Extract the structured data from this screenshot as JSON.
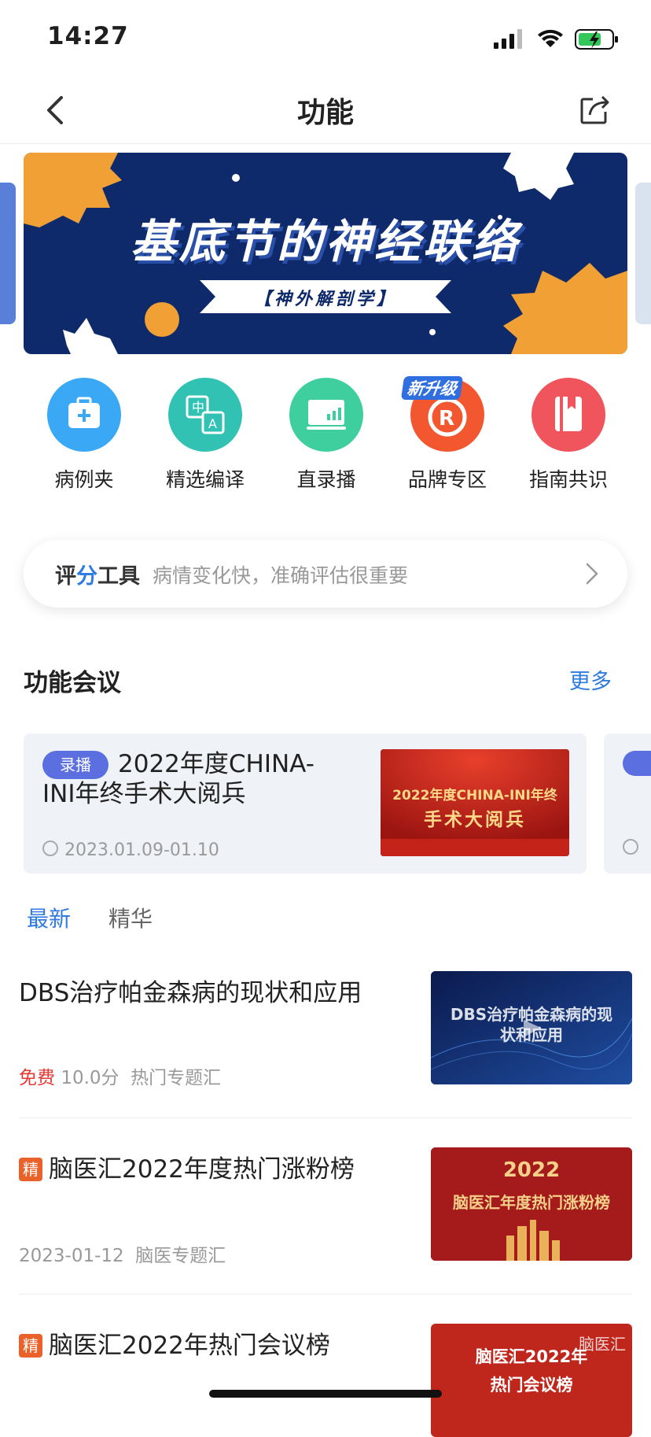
{
  "status_bar": {
    "time": "14:27"
  },
  "nav": {
    "title": "功能"
  },
  "banner": {
    "title": "基底节的神经联络",
    "subtitle": "【神外解剖学】"
  },
  "features": [
    {
      "label": "病例夹",
      "color": "#3aa8f5"
    },
    {
      "label": "精选编译",
      "color": "#31c2b4"
    },
    {
      "label": "直录播",
      "color": "#3fcf9e"
    },
    {
      "label": "品牌专区",
      "color": "#f2572f",
      "badge": "新升级"
    },
    {
      "label": "指南共识",
      "color": "#f0545c"
    }
  ],
  "score_tool": {
    "title_part1": "评",
    "title_part2": "分",
    "title_part3": "工具",
    "description": "病情变化快，准确评估很重要"
  },
  "section": {
    "title": "功能会议",
    "more": "更多"
  },
  "conference": {
    "tag": "录播",
    "title": "2022年度CHINA-INI年终手术大阅兵",
    "date": "2023.01.09-01.10",
    "image_line1": "2022年度CHINA-INI年终",
    "image_line2": "手术大阅兵"
  },
  "tabs": [
    {
      "label": "最新",
      "active": true
    },
    {
      "label": "精华",
      "active": false
    }
  ],
  "articles": [
    {
      "title": "DBS治疗帕金森病的现状和应用",
      "free": "免费",
      "score": "10.0分",
      "category": "热门专题汇",
      "thumb_text": "DBS治疗帕金森病的现状和应用"
    },
    {
      "badge": "精",
      "title": "脑医汇2022年度热门涨粉榜",
      "date": "2023-01-12",
      "category": "脑医专题汇",
      "thumb_line1": "2022",
      "thumb_line2": "脑医汇年度热门涨粉榜"
    },
    {
      "badge": "精",
      "title": "脑医汇2022年热门会议榜",
      "thumb_line1": "脑医汇2022年",
      "thumb_line2": "热门会议榜",
      "thumb_logo": "脑医汇"
    }
  ]
}
